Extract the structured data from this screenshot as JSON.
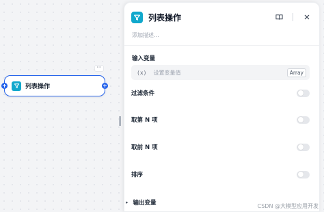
{
  "node": {
    "title": "列表操作",
    "more_label": "···",
    "handle_left": "+",
    "handle_right": "+"
  },
  "panel": {
    "title": "列表操作",
    "description_placeholder": "添加描述...",
    "input_section": {
      "label": "输入变量",
      "var_symbol": "(x)",
      "placeholder": "设置变量值",
      "type_badge": "Array"
    },
    "options": [
      {
        "label": "过滤条件",
        "enabled": false
      },
      {
        "label": "取第 N 项",
        "enabled": false
      },
      {
        "label": "取前 N 项",
        "enabled": false
      },
      {
        "label": "排序",
        "enabled": false
      }
    ],
    "output_section": {
      "label": "输出变量"
    }
  },
  "watermark": "CSDN @大模型应用开发",
  "colors": {
    "accent": "#2563eb",
    "node_icon": "#11a8cc",
    "toggle_off": "#e5e7eb"
  }
}
